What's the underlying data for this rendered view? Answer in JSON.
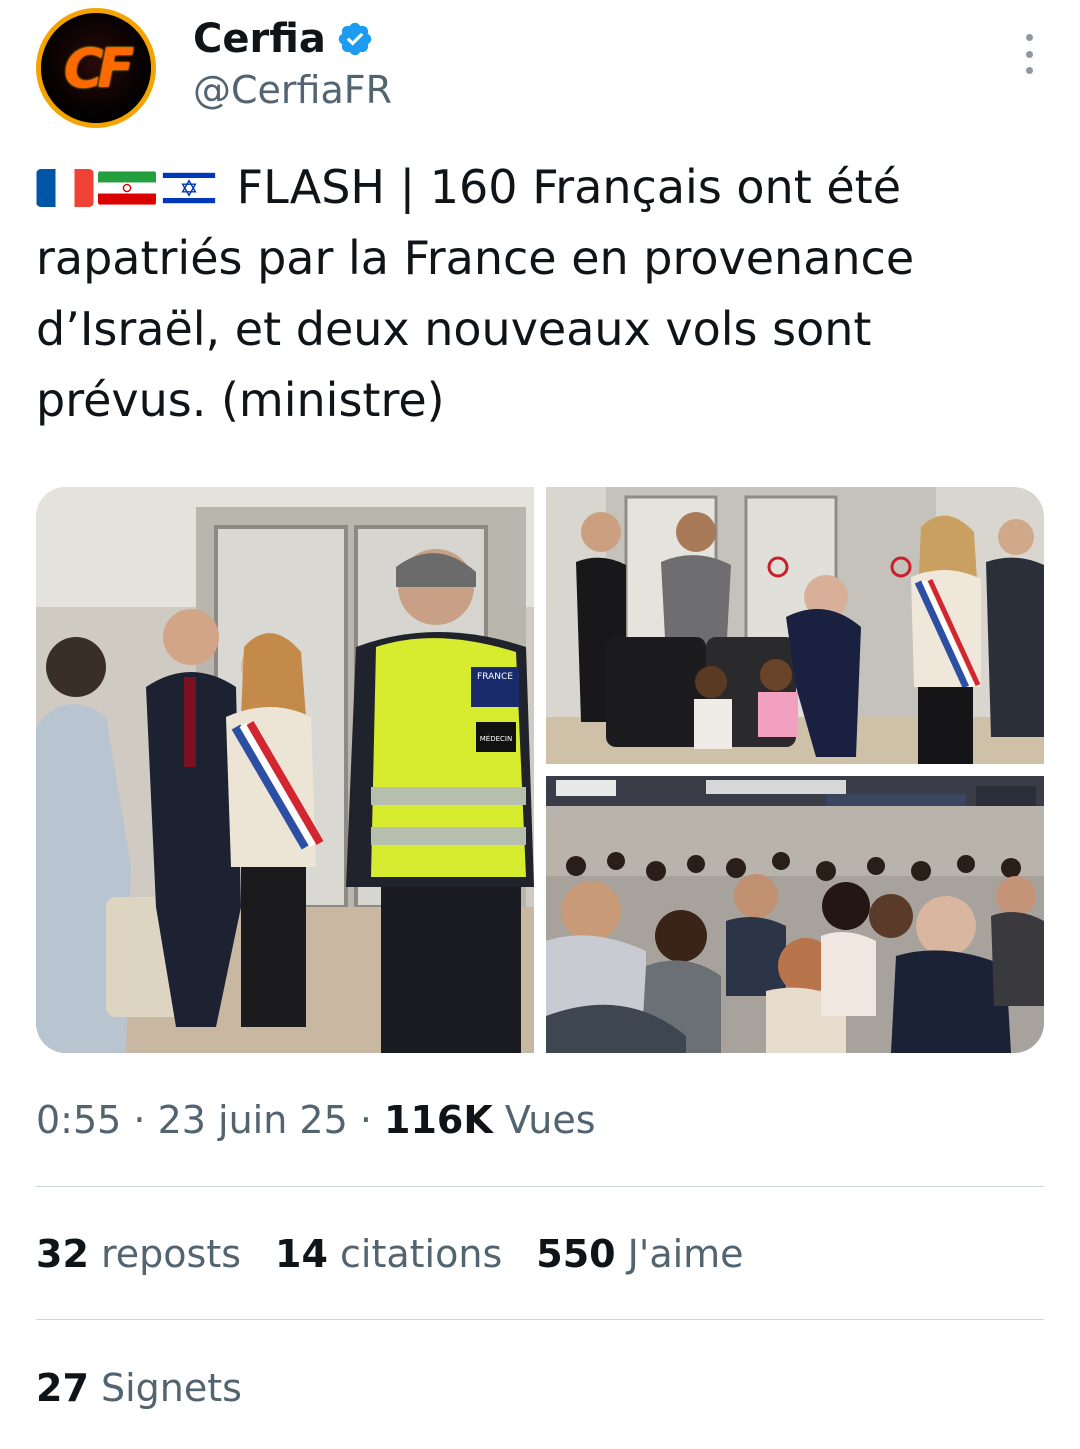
{
  "author": {
    "display_name": "Cerfia",
    "handle": "@CerfiaFR",
    "avatar_text": "CF",
    "verified": true
  },
  "tweet": {
    "flags": [
      "france-flag",
      "iran-flag",
      "israel-flag"
    ],
    "text": "FLASH | 160 Français ont été rapatriés par la France en provenance d’Israël, et deux nouveaux vols sont prévus. (ministre)"
  },
  "media": {
    "photo_1": {
      "vest_top": "FRANCE",
      "vest_badge": "MÉDECIN"
    },
    "count": 3
  },
  "meta": {
    "time": "0:55",
    "separator": " · ",
    "date": "23 juin 25",
    "views_count": "116K",
    "views_label": "Vues"
  },
  "stats": {
    "reposts_count": "32",
    "reposts_label": "reposts",
    "quotes_count": "14",
    "quotes_label": "citations",
    "likes_count": "550",
    "likes_label": "J'aime",
    "bookmarks_count": "27",
    "bookmarks_label": "Signets"
  },
  "colors": {
    "text_primary": "#0f1419",
    "text_secondary": "#536471",
    "verified": "#1d9bf0",
    "divider": "#d0d7dc",
    "avatar_accent": "#ff6a00"
  }
}
